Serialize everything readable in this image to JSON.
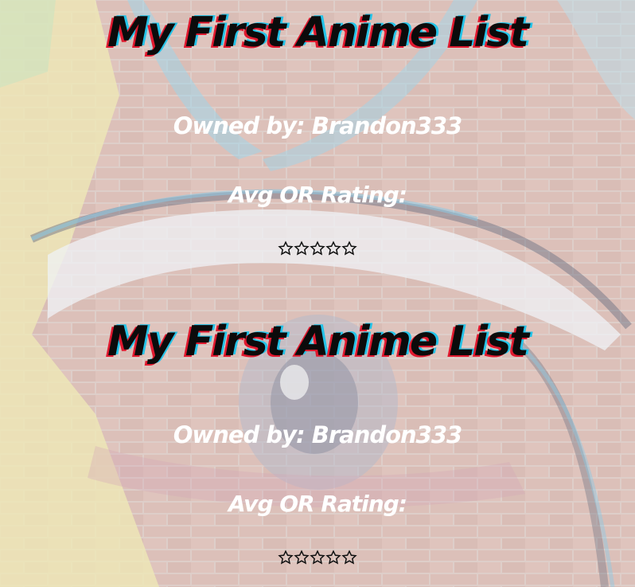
{
  "lists": [
    {
      "title": "My First Anime List",
      "owner": "Owned by: Brandon333",
      "rating_label": "Avg OR Rating:",
      "rating": {
        "value": 0,
        "max": 5
      }
    },
    {
      "title": "My First Anime List",
      "owner": "Owned by: Brandon333",
      "rating_label": "Avg OR Rating:",
      "rating": {
        "value": 0,
        "max": 5
      }
    }
  ],
  "colors": {
    "title_text": "#0b0b0b",
    "title_shadow_red": "#e0192f",
    "title_shadow_cyan": "#24c3e8",
    "body_text": "#ffffff",
    "star_outline": "#111111"
  },
  "icons": {
    "star": "star-outline-icon"
  }
}
